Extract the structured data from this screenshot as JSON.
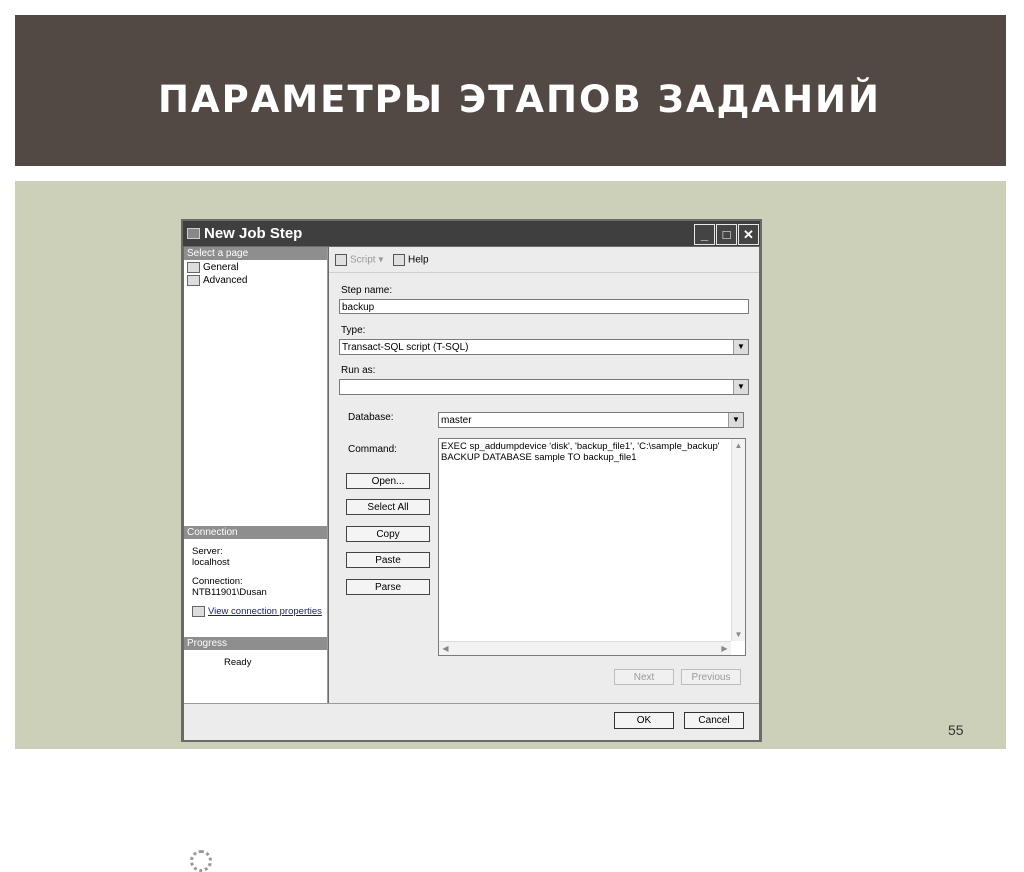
{
  "slide": {
    "title": "ПАРАМЕТРЫ ЭТАПОВ ЗАДАНИЙ",
    "page_number": "55"
  },
  "window": {
    "title": "New Job Step",
    "controls": {
      "minimize": "_",
      "maximize": "□",
      "close": "✕"
    }
  },
  "left_pane": {
    "select_page_header": "Select a page",
    "pages": [
      "General",
      "Advanced"
    ],
    "connection_header": "Connection",
    "server_label": "Server:",
    "server_value": "localhost",
    "connection_label": "Connection:",
    "connection_value": "NTB11901\\Dusan",
    "view_link": "View connection properties",
    "progress_header": "Progress",
    "progress_status": "Ready"
  },
  "toolbar": {
    "script_label": "Script",
    "help_label": "Help"
  },
  "form": {
    "step_name_label": "Step name:",
    "step_name_value": "backup",
    "type_label": "Type:",
    "type_value": "Transact-SQL script (T-SQL)",
    "run_as_label": "Run as:",
    "run_as_value": "",
    "database_label": "Database:",
    "database_value": "master",
    "command_label": "Command:",
    "command_text": "EXEC sp_addumpdevice 'disk', 'backup_file1', 'C:\\sample_backup'\nBACKUP DATABASE sample TO backup_file1"
  },
  "command_buttons": {
    "open": "Open...",
    "select_all": "Select All",
    "copy": "Copy",
    "paste": "Paste",
    "parse": "Parse"
  },
  "step_nav": {
    "next": "Next",
    "previous": "Previous"
  },
  "dialog_buttons": {
    "ok": "OK",
    "cancel": "Cancel"
  },
  "colors": {
    "header_bg": "#524844",
    "content_bg": "#cdd0b9",
    "titlebar_bg": "#3f3f3f",
    "pane_header_bg": "#8e8e8e"
  }
}
